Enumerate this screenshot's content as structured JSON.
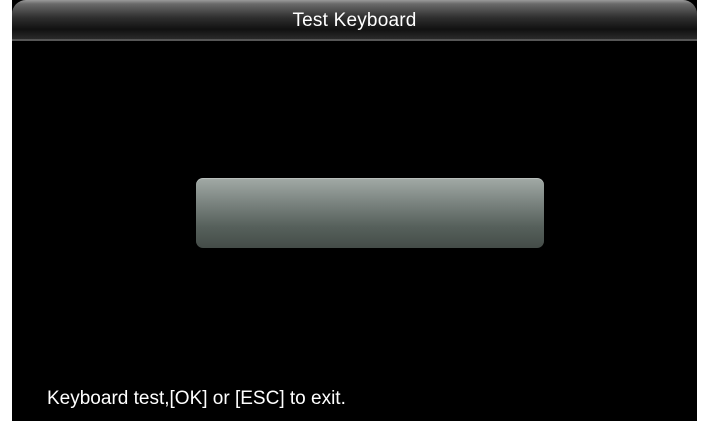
{
  "window": {
    "title": "Test Keyboard"
  },
  "main": {
    "key_display_value": "",
    "status_message": "Keyboard test,[OK] or [ESC] to exit."
  },
  "colors": {
    "background": "#000000",
    "title_bar": "#2f2f2f",
    "key_display": "#6a736f",
    "text": "#ffffff"
  }
}
